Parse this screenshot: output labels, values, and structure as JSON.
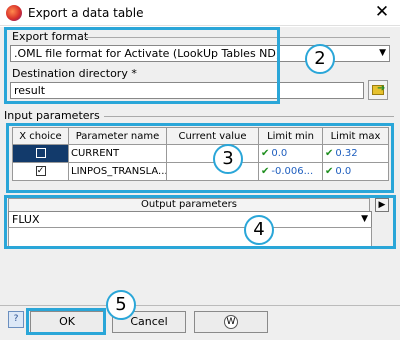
{
  "window": {
    "title": "Export a data table",
    "close_glyph": "✕"
  },
  "export_format": {
    "group_title": "Export format",
    "selected": ".OML file format for Activate (LookUp Tables ND)",
    "arrow": "▼",
    "destination_label": "Destination directory *",
    "destination_value": "result",
    "browse_arrow": "➜"
  },
  "input_parameters": {
    "group_title": "Input parameters",
    "columns": [
      "X choice",
      "Parameter name",
      "Current value",
      "Limit min",
      "Limit max"
    ],
    "rows": [
      {
        "x_choice": "",
        "name": "CURRENT",
        "current": "",
        "min": "0.0",
        "max": "0.32"
      },
      {
        "x_choice": "✓",
        "name": "LINPOS_TRANSLA...",
        "current": "",
        "min": "-0.006...",
        "max": "0.0"
      }
    ],
    "tick_glyph": "✔"
  },
  "output_parameters": {
    "header": "Output parameters",
    "selected": "FLUX",
    "arrow": "▼",
    "expand_glyph": "▶"
  },
  "buttons": {
    "help": "?",
    "ok": "OK",
    "cancel": "Cancel",
    "about": "W"
  },
  "callouts": [
    "2",
    "3",
    "4",
    "5"
  ],
  "colors": {
    "accent": "#2aa6d8",
    "selected_row": "#123a6b",
    "tick": "#1f8f1f"
  }
}
